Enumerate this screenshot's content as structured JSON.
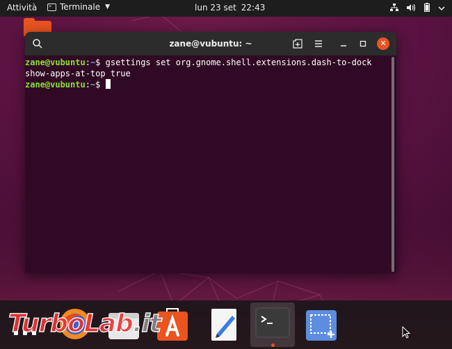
{
  "topbar": {
    "activities": "Attività",
    "app_name": "Terminale",
    "date": "lun 23 set",
    "time": "22:43"
  },
  "terminal": {
    "title": "zane@vubuntu: ~",
    "lines": [
      {
        "user": "zane@vubuntu",
        "sep": ":",
        "path": "~",
        "prompt": "$ ",
        "text": "gsettings set org.gnome.shell.extensions.dash-to-dock"
      },
      {
        "text": "show-apps-at-top true"
      },
      {
        "user": "zane@vubuntu",
        "sep": ":",
        "path": "~",
        "prompt": "$ ",
        "text": ""
      }
    ]
  },
  "dock": {
    "items": [
      "show-applications",
      "browser",
      "files",
      "software",
      "text-editor",
      "terminal",
      "screenshot"
    ],
    "active": "terminal"
  },
  "watermark": {
    "part1": "TurboLab",
    "part2": ".it"
  },
  "colors": {
    "accent": "#e95420",
    "terminal_bg": "#300a24",
    "prompt_user": "#8ae234",
    "prompt_path": "#729fcf",
    "topbar_bg": "#1d1d1d"
  },
  "icons": {
    "tray": [
      "network-icon",
      "volume-icon",
      "battery-icon",
      "power-menu-icon"
    ]
  }
}
